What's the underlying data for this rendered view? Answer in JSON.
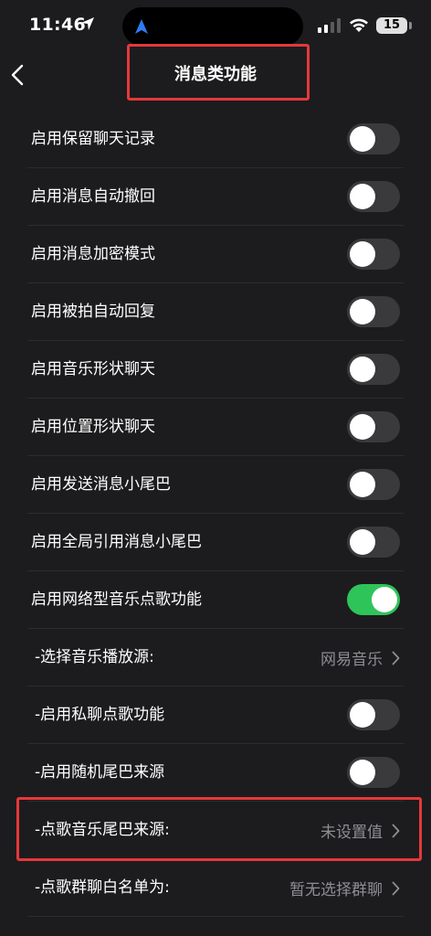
{
  "status": {
    "time": "11:46",
    "battery": "15"
  },
  "nav": {
    "title": "消息类功能"
  },
  "rows": [
    {
      "label": "启用保留聊天记录",
      "type": "toggle",
      "on": false
    },
    {
      "label": "启用消息自动撤回",
      "type": "toggle",
      "on": false
    },
    {
      "label": "启用消息加密模式",
      "type": "toggle",
      "on": false
    },
    {
      "label": "启用被拍自动回复",
      "type": "toggle",
      "on": false
    },
    {
      "label": "启用音乐形状聊天",
      "type": "toggle",
      "on": false
    },
    {
      "label": "启用位置形状聊天",
      "type": "toggle",
      "on": false
    },
    {
      "label": "启用发送消息小尾巴",
      "type": "toggle",
      "on": false
    },
    {
      "label": "启用全局引用消息小尾巴",
      "type": "toggle",
      "on": false
    },
    {
      "label": "启用网络型音乐点歌功能",
      "type": "toggle",
      "on": true
    },
    {
      "label": "-选择音乐播放源:",
      "type": "select",
      "value": "网易音乐"
    },
    {
      "label": "-启用私聊点歌功能",
      "type": "toggle",
      "on": false
    },
    {
      "label": "-启用随机尾巴来源",
      "type": "toggle",
      "on": false
    },
    {
      "label": "-点歌音乐尾巴来源:",
      "type": "select",
      "value": "未设置值"
    },
    {
      "label": "-点歌群聊白名单为:",
      "type": "select",
      "value": "暂无选择群聊"
    }
  ],
  "colors": {
    "background": "#1c1c1e",
    "toggle_on": "#2fc45a",
    "toggle_off": "#3a3a3c",
    "highlight": "#e5383b",
    "secondary_text": "#8e8e93"
  }
}
